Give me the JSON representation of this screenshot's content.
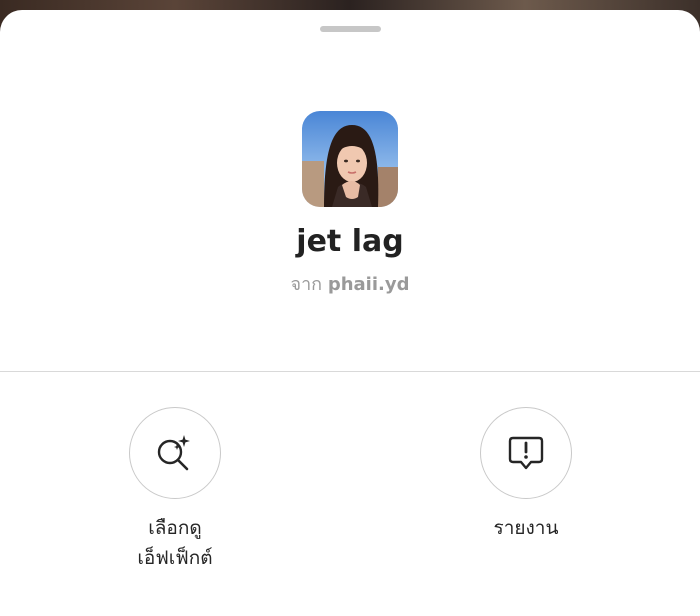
{
  "effect": {
    "title": "jet lag",
    "creator_prefix": "จาก",
    "creator_name": "phaii.yd"
  },
  "actions": {
    "browse_effects": {
      "label_line1": "เลือกดู",
      "label_line2": "เอ็ฟเฟ็กต์",
      "icon": "search-sparkle-icon"
    },
    "report": {
      "label": "รายงาน",
      "icon": "report-exclamation-icon"
    }
  },
  "colors": {
    "sheet_background": "#ffffff",
    "title_text": "#222222",
    "secondary_text": "#9a9a9a",
    "icon_stroke": "#262626",
    "circle_border": "#c9c9c9",
    "divider": "#d9d9d9"
  }
}
